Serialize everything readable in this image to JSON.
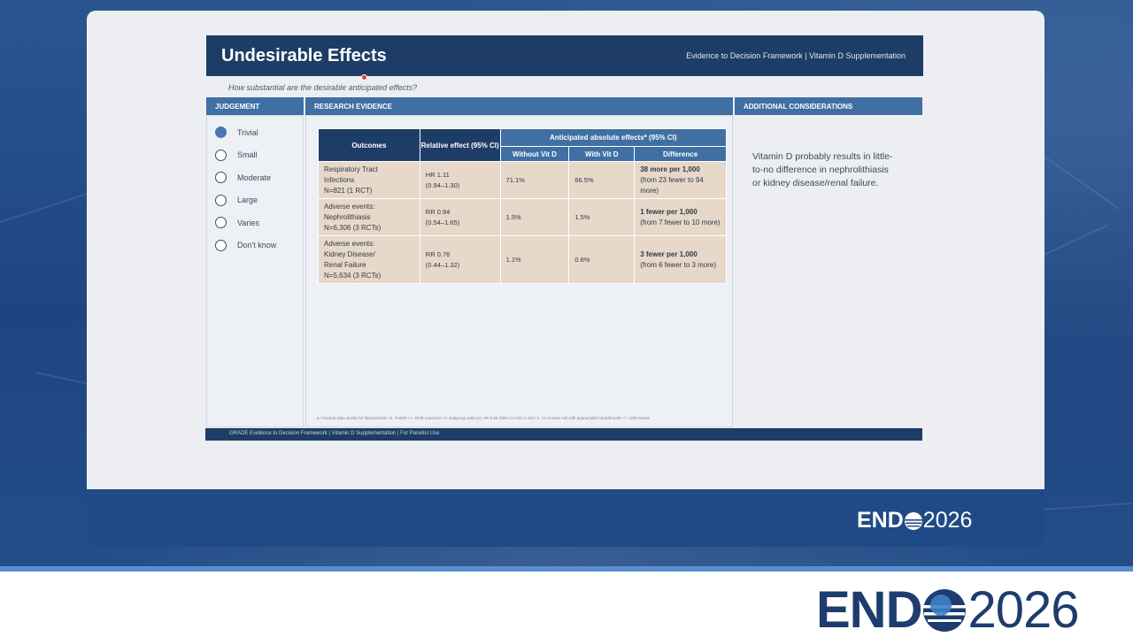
{
  "slide": {
    "title": "Undesirable Effects",
    "breadcrumb": "Evidence to Decision Framework  |  Vitamin D Supplementation",
    "question": "How substantial are the desirable anticipated effects?",
    "columns": {
      "judgement": "JUDGEMENT",
      "research": "RESEARCH EVIDENCE",
      "additional": "ADDITIONAL CONSIDERATIONS"
    },
    "judgement_options": [
      {
        "label": "Trivial",
        "selected": true
      },
      {
        "label": "Small",
        "selected": false
      },
      {
        "label": "Moderate",
        "selected": false
      },
      {
        "label": "Large",
        "selected": false
      },
      {
        "label": "Varies",
        "selected": false
      },
      {
        "label": "Don't know",
        "selected": false
      }
    ],
    "table": {
      "headers": {
        "outcomes": "Outcomes",
        "relative": "Relative effect (95% CI)",
        "anticipated": "Anticipated absolute effects* (95% CI)",
        "without": "Without Vit D",
        "with": "With Vit D",
        "difference": "Difference"
      },
      "rows": [
        {
          "outcome_1": "Respiratory Tract",
          "outcome_2": "Infections",
          "outcome_3": "N=821 (1 RCT)",
          "rel_1": "HR 1.11",
          "rel_2": "(0.94–1.30)",
          "without": "71.1%",
          "with": "66.5%",
          "diff_bold": "38 more per 1,000",
          "diff_rest": "(from 23 fewer to 94 more)"
        },
        {
          "outcome_1": "Adverse events:",
          "outcome_2": "Nephrolithiasis",
          "outcome_3": "N=6,306 (3 RCTs)",
          "rel_1": "RR 0.94",
          "rel_2": "(0.54–1.65)",
          "without": "1.5%",
          "with": "1.5%",
          "diff_bold": "1 fewer per 1,000",
          "diff_rest": "(from 7 fewer to 10 more)"
        },
        {
          "outcome_1": "Adverse events:",
          "outcome_2": "Kidney Disease/",
          "outcome_3": "Renal Failure",
          "outcome_4": "N=5,634 (3 RCTs)",
          "rel_1": "RR 0.76",
          "rel_2": "(0.44–1.32)",
          "without": "1.1%",
          "with": "0.8%",
          "diff_bold": "3 fewer per 1,000",
          "diff_rest": "(from 6 fewer to 3 more)"
        }
      ]
    },
    "additional_text": "Vitamin D probably results in little-to-no difference in nephrolithiasis or kidney disease/renal failure.",
    "footnote": "a. Fracture data similar for hip/vertebral  •  b. I²>50%  •  c. ROB concerns  •  d. Subgroup (≥65 yr): HR 0.88 (95% CI 0.52–1.32)  •  e. CI crosses null with appreciable harm/benefit  •  f. <100 events",
    "footer": "GRADE Evidence to Decision Framework  |  Vitamin D Supplementation  |  For Panelist Use"
  },
  "branding": {
    "logo_bold": "END",
    "logo_year": "2026"
  },
  "colors": {
    "header_navy": "#1e3d66",
    "column_blue": "#3f6fa3",
    "cell_tan": "#e7d8c9",
    "selected_radio": "#4a74b5"
  }
}
